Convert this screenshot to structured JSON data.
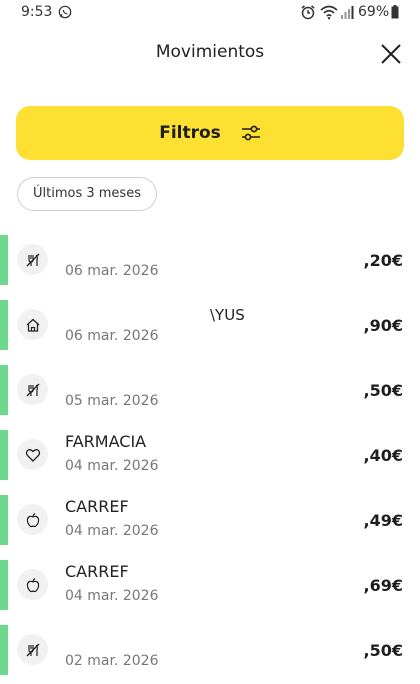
{
  "status_bar": {
    "time": "9:53",
    "battery": "69%",
    "icons": [
      "whatsapp-icon",
      "alarm-icon",
      "wifi-icon",
      "signal-icon",
      "battery-icon"
    ]
  },
  "header": {
    "title": "Movimientos",
    "close_icon": "close-icon"
  },
  "filters": {
    "label": "Filtros",
    "icon": "sliders-icon",
    "color": "#fde031"
  },
  "period_chip": {
    "label": "Últimos 3 meses"
  },
  "transactions": [
    {
      "name": "",
      "name_mid": "",
      "date": "06 mar. 2026",
      "amount": ",20€",
      "icon": "no-food-icon"
    },
    {
      "name": "",
      "name_mid": "\\YUS",
      "date": "06 mar. 2026",
      "amount": ",90€",
      "icon": "home-icon"
    },
    {
      "name": "",
      "name_mid": "",
      "date": "05 mar. 2026",
      "amount": ",50€",
      "icon": "no-food-icon"
    },
    {
      "name": "FARMACIA",
      "name_mid": "",
      "date": "04 mar. 2026",
      "amount": ",40€",
      "icon": "heart-icon"
    },
    {
      "name": "CARREF",
      "name_mid": "",
      "date": "04 mar. 2026",
      "amount": ",49€",
      "icon": "apple-icon"
    },
    {
      "name": "CARREF",
      "name_mid": "",
      "date": "04 mar. 2026",
      "amount": ",69€",
      "icon": "apple-icon"
    },
    {
      "name": "",
      "name_mid": "",
      "date": "02 mar. 2026",
      "amount": ",50€",
      "icon": "no-food-icon"
    }
  ],
  "colors": {
    "income_bar": "#6ed98c",
    "icon_bg": "#f1f1f1"
  }
}
